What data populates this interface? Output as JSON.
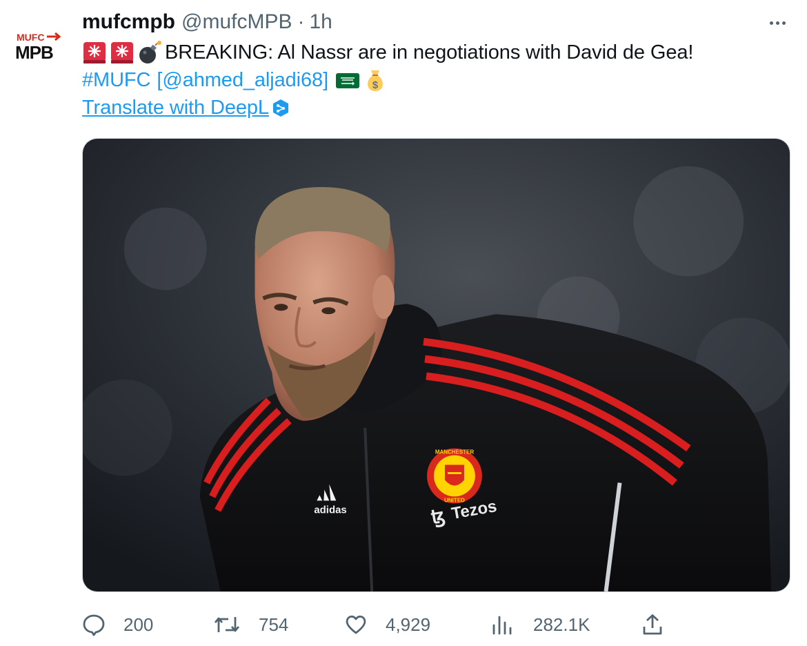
{
  "author": {
    "display_name": "mufcmpb",
    "handle": "@mufcMPB",
    "separator": "·",
    "timestamp": "1h",
    "avatar_logo_top": "MUFC",
    "avatar_logo_bottom": "MPB",
    "avatar_color": "#da291c"
  },
  "tweet": {
    "line1_text": "BREAKING: Al Nassr are in negotiations with David de Gea!",
    "hashtag": "#MUFC",
    "bracket_open": "[",
    "mention": "@ahmed_aljadi68",
    "bracket_close": "]",
    "translate_link": "Translate with DeepL",
    "emojis": [
      "rotating-light",
      "rotating-light",
      "bomb",
      "saudi-flag",
      "money-bag"
    ]
  },
  "media": {
    "kit_brand": "adidas",
    "kit_sponsor": "Tezos",
    "crest_text_top": "MANCHESTER",
    "crest_text_bottom": "UNITED"
  },
  "actions": {
    "replies": "200",
    "retweets": "754",
    "likes": "4,929",
    "views": "282.1K"
  },
  "colors": {
    "text": "#0f1419",
    "secondary": "#536471",
    "link": "#1d9bf0",
    "jacket_stripe": "#d81e1e"
  }
}
